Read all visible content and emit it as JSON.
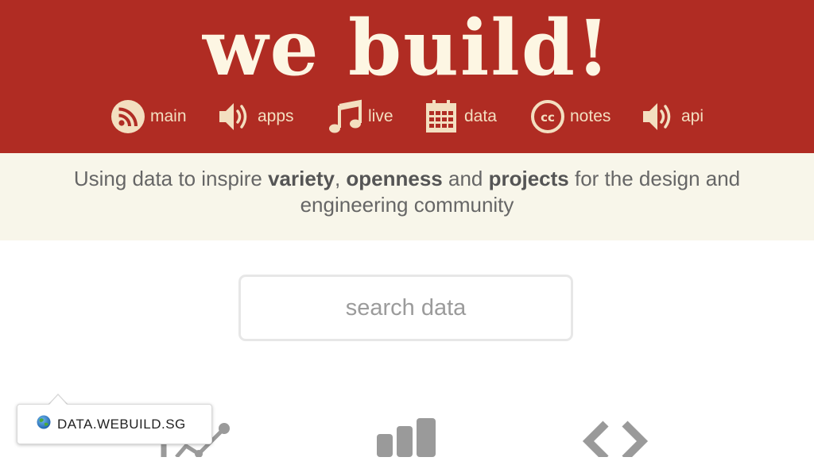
{
  "header": {
    "logo": "we build!",
    "nav": [
      {
        "icon": "rss-icon",
        "label": "main"
      },
      {
        "icon": "speaker-icon",
        "label": "apps"
      },
      {
        "icon": "music-note-icon",
        "label": "live"
      },
      {
        "icon": "calendar-icon",
        "label": "data"
      },
      {
        "icon": "creative-commons-icon",
        "label": "notes"
      },
      {
        "icon": "speaker-icon",
        "label": "api"
      }
    ]
  },
  "tagline": {
    "part1": "Using data to inspire ",
    "bold1": "variety",
    "part2": ", ",
    "bold2": "openness",
    "part3": " and ",
    "bold3": "projects",
    "part4": " for the design and engineering community"
  },
  "search": {
    "placeholder": "search data",
    "value": ""
  },
  "features": [
    {
      "icon": "line-chart-icon"
    },
    {
      "icon": "bar-chart-icon"
    },
    {
      "icon": "code-icon"
    }
  ],
  "tooltip": {
    "icon": "globe-icon",
    "text": "DATA.WEBUILD.SG"
  },
  "colors": {
    "header_bg": "#b02c23",
    "logo": "#fdf6e3",
    "nav": "#f3dfc0",
    "tagline_bg": "#f8f6ea",
    "text": "#666666",
    "icon_gray": "#9a9a9a"
  }
}
